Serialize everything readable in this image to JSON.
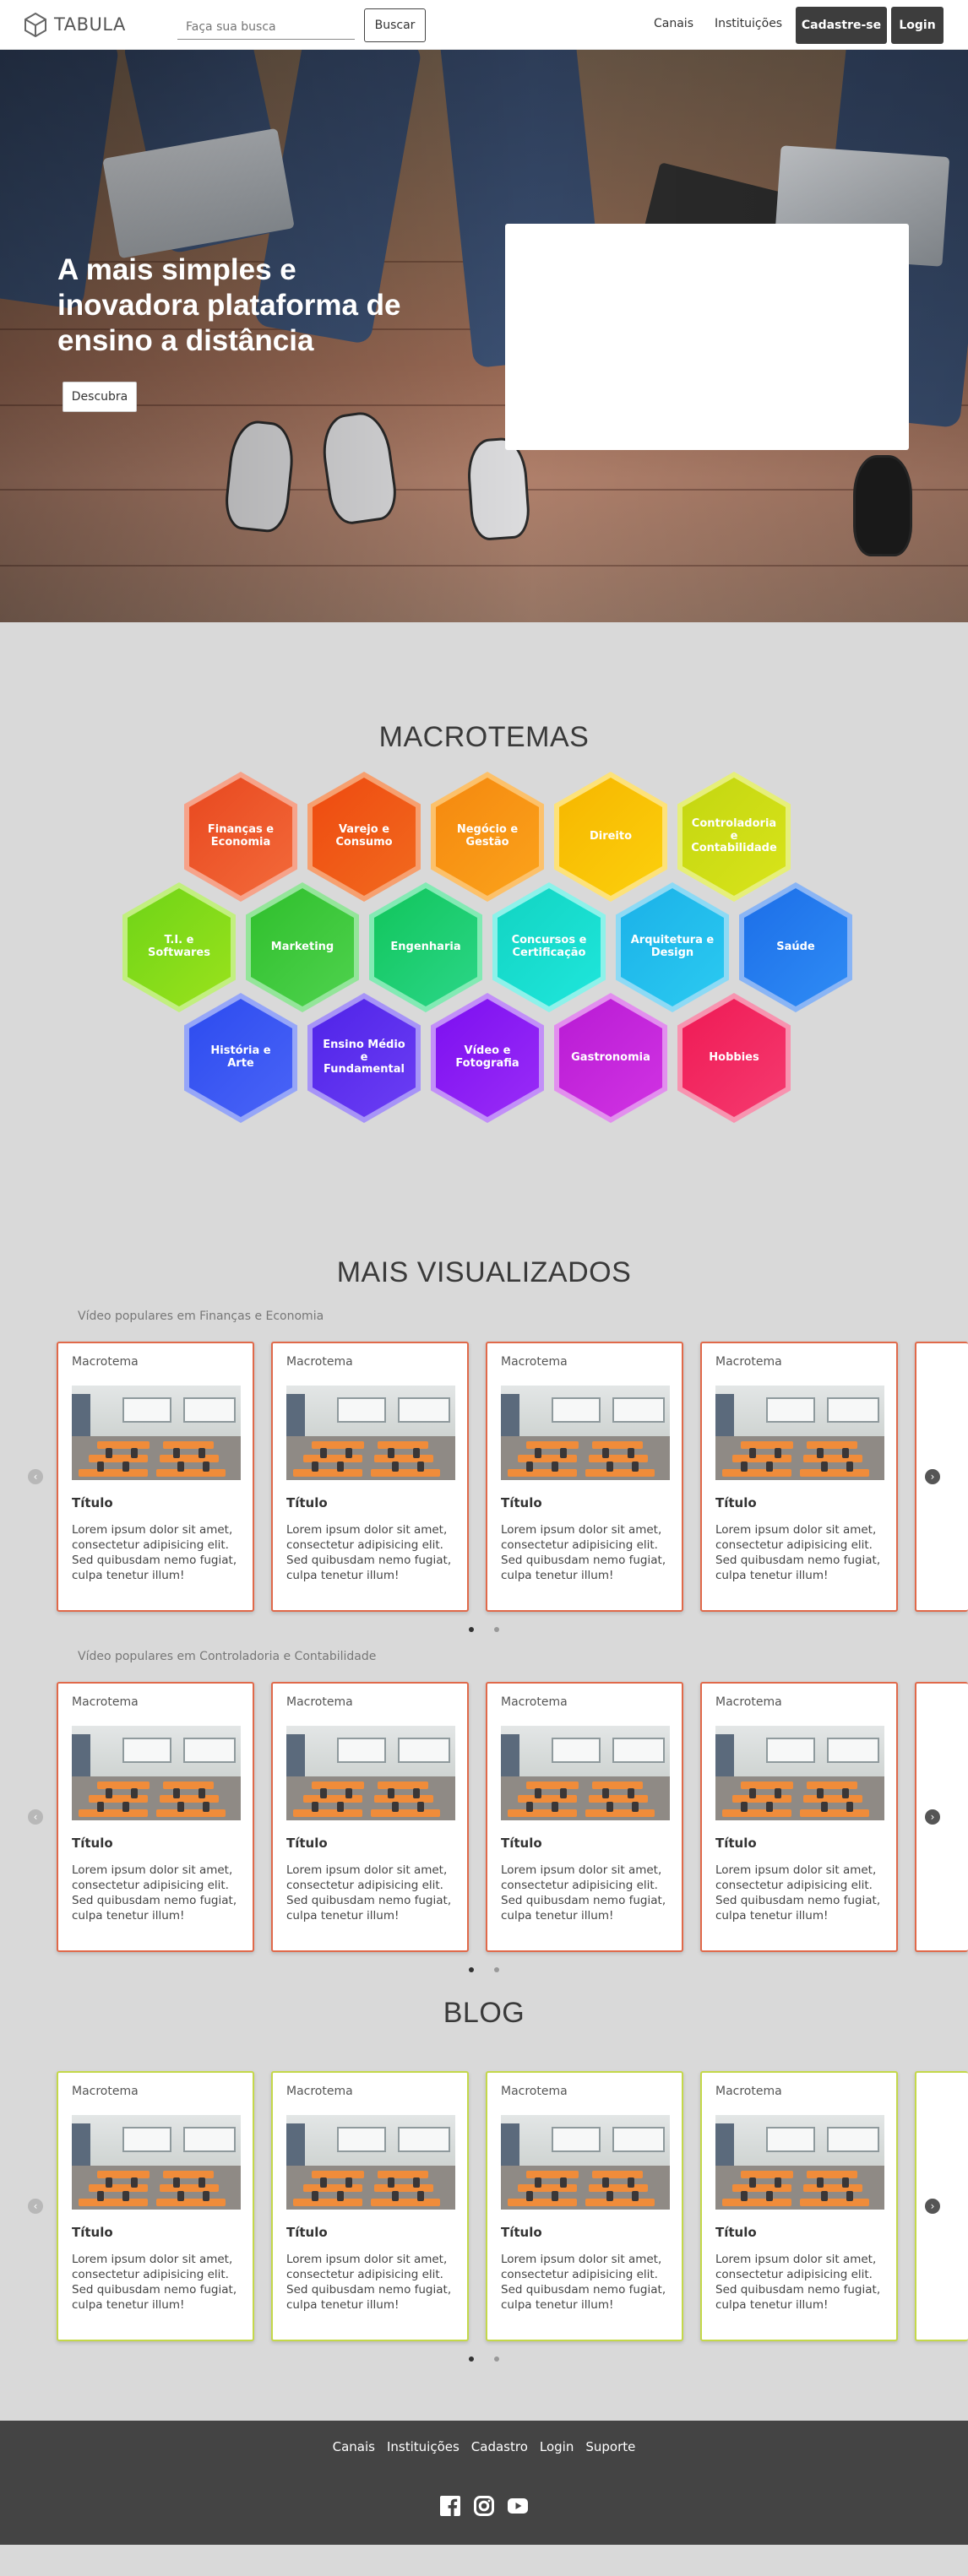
{
  "navbar": {
    "brand": "TABULA",
    "search_placeholder": "Faça sua busca",
    "search_button": "Buscar",
    "links": [
      "Canais",
      "Instituições"
    ],
    "signup_button": "Cadastre-se",
    "login_button": "Login"
  },
  "hero": {
    "title": "A mais simples e inovadora plataforma de ensino a distância",
    "button": "Descubra"
  },
  "macrotemas": {
    "title": "MACROTEMAS",
    "items": [
      {
        "label": "Finanças e Economia",
        "colors": [
          "#e8481f",
          "#f36a3a"
        ],
        "border": "#f6a38a"
      },
      {
        "label": "Varejo e Consumo",
        "colors": [
          "#ee4a10",
          "#f26a1e"
        ],
        "border": "#f6a070"
      },
      {
        "label": "Negócio e Gestão",
        "colors": [
          "#f5880f",
          "#fba31b"
        ],
        "border": "#fcc16b"
      },
      {
        "label": "Direito",
        "colors": [
          "#f6b600",
          "#fcd00c"
        ],
        "border": "#fde27a"
      },
      {
        "label": "Controladoria e Contabilidade",
        "colors": [
          "#c3d611",
          "#d9e41a"
        ],
        "border": "#e6ef7a"
      },
      {
        "label": "T.I. e Softwares",
        "colors": [
          "#6fd417",
          "#9ae21c"
        ],
        "border": "#c2ef80"
      },
      {
        "label": "Marketing",
        "colors": [
          "#2fbf2c",
          "#4fd24e"
        ],
        "border": "#94e59a"
      },
      {
        "label": "Engenharia",
        "colors": [
          "#11c55b",
          "#2bd688"
        ],
        "border": "#83eab4"
      },
      {
        "label": "Concursos e Certificação",
        "colors": [
          "#12d4c2",
          "#1fe6dc"
        ],
        "border": "#8df2ea"
      },
      {
        "label": "Arquitetura e Design",
        "colors": [
          "#1bb1e8",
          "#2bcaf1"
        ],
        "border": "#8ddaf5"
      },
      {
        "label": "Saúde",
        "colors": [
          "#1c6ee8",
          "#2f8cf5"
        ],
        "border": "#8ab5f5"
      },
      {
        "label": "História e Arte",
        "colors": [
          "#2c4bef",
          "#4a64f7"
        ],
        "border": "#96a6f8"
      },
      {
        "label": "Ensino Médio e Fundamental",
        "colors": [
          "#4f23e8",
          "#6c3ef4"
        ],
        "border": "#a794f7"
      },
      {
        "label": "Vídeo e Fotografia",
        "colors": [
          "#7c0ff0",
          "#9a2cf7"
        ],
        "border": "#c28ff8"
      },
      {
        "label": "Gastronomia",
        "colors": [
          "#b81bd4",
          "#d133e3"
        ],
        "border": "#e28fee"
      },
      {
        "label": "Hobbies",
        "colors": [
          "#ef1a55",
          "#f53a6f"
        ],
        "border": "#f794b0"
      }
    ]
  },
  "mais_visualizados": {
    "title": "MAIS VISUALIZADOS",
    "carousels": [
      {
        "subtitle": "Vídeo populares em Finanças e Economia",
        "cards": [
          {
            "tag": "Macrotema",
            "title": "Título",
            "text": "Lorem ipsum dolor sit amet, consectetur adipisicing elit. Sed quibusdam nemo fugiat, culpa tenetur illum!"
          },
          {
            "tag": "Macrotema",
            "title": "Título",
            "text": "Lorem ipsum dolor sit amet, consectetur adipisicing elit. Sed quibusdam nemo fugiat, culpa tenetur illum!"
          },
          {
            "tag": "Macrotema",
            "title": "Título",
            "text": "Lorem ipsum dolor sit amet, consectetur adipisicing elit. Sed quibusdam nemo fugiat, culpa tenetur illum!"
          },
          {
            "tag": "Macrotema",
            "title": "Título",
            "text": "Lorem ipsum dolor sit amet, consectetur adipisicing elit. Sed quibusdam nemo fugiat, culpa tenetur illum!"
          }
        ]
      },
      {
        "subtitle": "Vídeo populares em Controladoria e Contabilidade",
        "cards": [
          {
            "tag": "Macrotema",
            "title": "Título",
            "text": "Lorem ipsum dolor sit amet, consectetur adipisicing elit. Sed quibusdam nemo fugiat, culpa tenetur illum!"
          },
          {
            "tag": "Macrotema",
            "title": "Título",
            "text": "Lorem ipsum dolor sit amet, consectetur adipisicing elit. Sed quibusdam nemo fugiat, culpa tenetur illum!"
          },
          {
            "tag": "Macrotema",
            "title": "Título",
            "text": "Lorem ipsum dolor sit amet, consectetur adipisicing elit. Sed quibusdam nemo fugiat, culpa tenetur illum!"
          },
          {
            "tag": "Macrotema",
            "title": "Título",
            "text": "Lorem ipsum dolor sit amet, consectetur adipisicing elit. Sed quibusdam nemo fugiat, culpa tenetur illum!"
          }
        ]
      }
    ]
  },
  "blog": {
    "title": "BLOG",
    "cards": [
      {
        "tag": "Macrotema",
        "title": "Título",
        "text": "Lorem ipsum dolor sit amet, consectetur adipisicing elit. Sed quibusdam nemo fugiat, culpa tenetur illum!"
      },
      {
        "tag": "Macrotema",
        "title": "Título",
        "text": "Lorem ipsum dolor sit amet, consectetur adipisicing elit. Sed quibusdam nemo fugiat, culpa tenetur illum!"
      },
      {
        "tag": "Macrotema",
        "title": "Título",
        "text": "Lorem ipsum dolor sit amet, consectetur adipisicing elit. Sed quibusdam nemo fugiat, culpa tenetur illum!"
      },
      {
        "tag": "Macrotema",
        "title": "Título",
        "text": "Lorem ipsum dolor sit amet, consectetur adipisicing elit. Sed quibusdam nemo fugiat, culpa tenetur illum!"
      }
    ]
  },
  "footer": {
    "links": [
      "Canais",
      "Instituições",
      "Cadastro",
      "Login",
      "Suporte"
    ],
    "icons": [
      "facebook-icon",
      "instagram-icon",
      "youtube-icon"
    ]
  },
  "colors": {
    "card_border_orange": "#e0694a",
    "card_border_green": "#c4d84a",
    "dark_button": "#3d3d3d",
    "footer_bg": "#444444",
    "page_bg": "#d9d9d9"
  }
}
